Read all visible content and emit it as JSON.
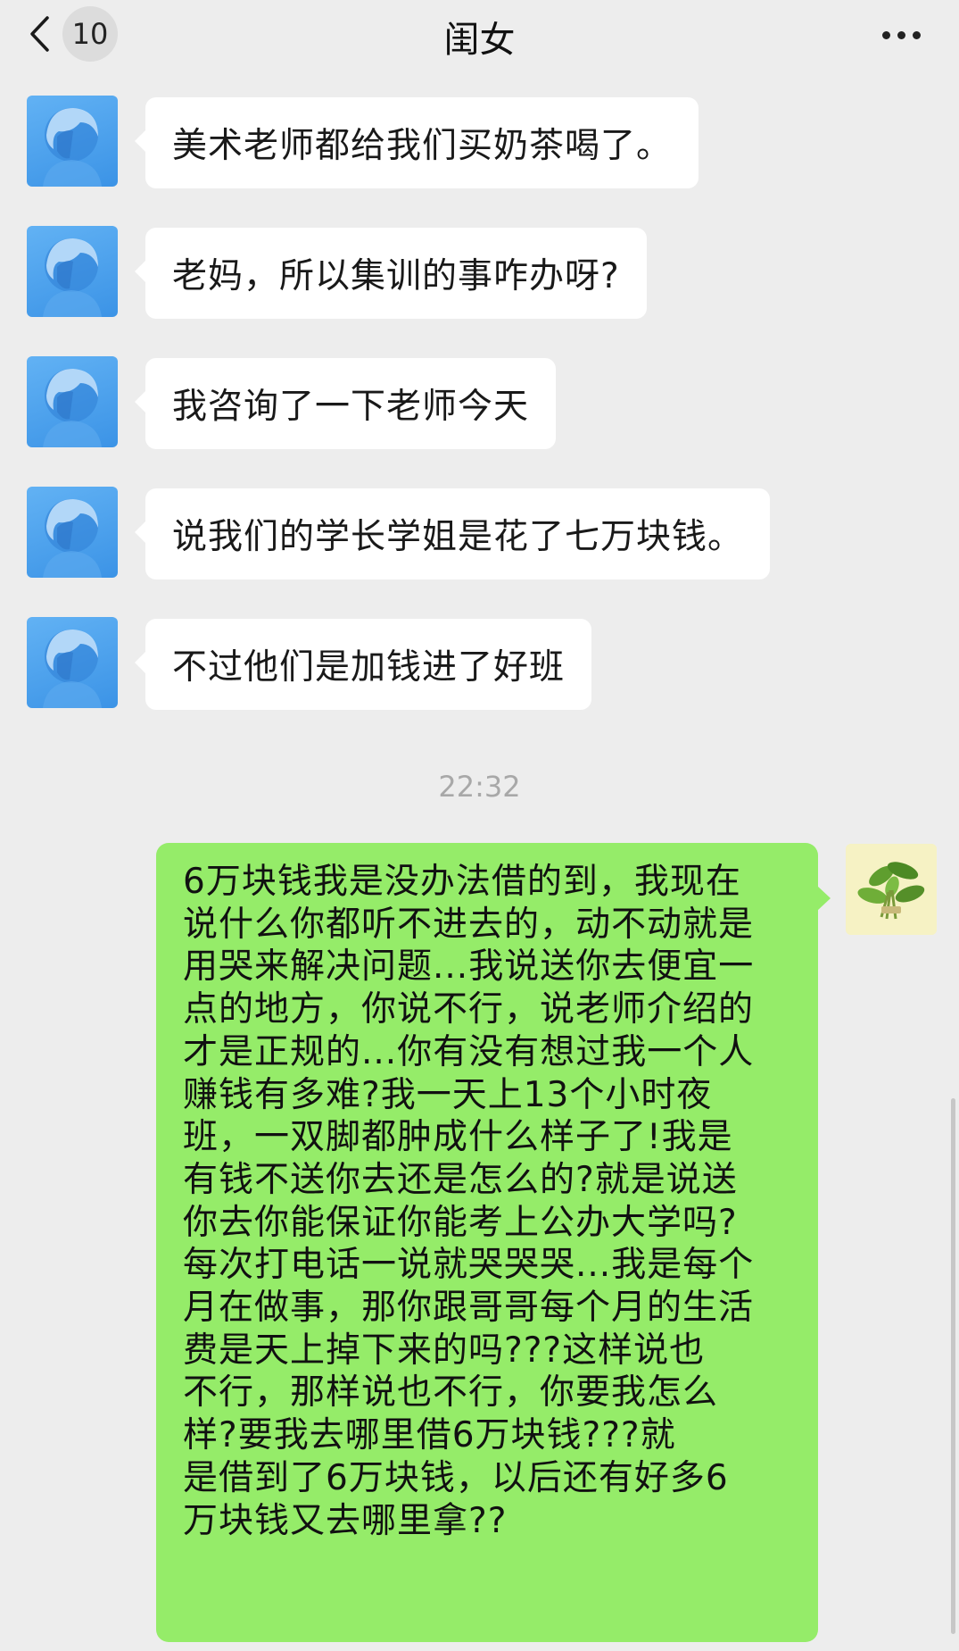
{
  "header": {
    "title": "闺女",
    "unread_count": "10"
  },
  "messages": [
    {
      "sender": "闺女",
      "text": "美术老师都给我们买奶茶喝了。"
    },
    {
      "sender": "闺女",
      "text": "老妈，所以集训的事咋办呀?"
    },
    {
      "sender": "闺女",
      "text": "我咨询了一下老师今天"
    },
    {
      "sender": "闺女",
      "text": "说我们的学长学姐是花了七万块钱。"
    },
    {
      "sender": "闺女",
      "text": "不过他们是加钱进了好班"
    }
  ],
  "timestamp": "22:32",
  "outgoing": {
    "lines": [
      "6万块钱我是没办法借的到，我现在",
      "说什么你都听不进去的，动不动就是",
      "用哭来解决问题...我说送你去便宜一",
      "点的地方，你说不行，说老师介绍的",
      "才是正规的...你有没有想过我一个人",
      "赚钱有多难?我一天上13个小时夜",
      "班，一双脚都肿成什么样子了!我是",
      "有钱不送你去还是怎么的?就是说送",
      "你去你能保证你能考上公办大学吗?",
      "每次打电话一说就哭哭哭...我是每个",
      "月在做事，那你跟哥哥每个月的生活",
      "费是天上掉下来的吗???这样说也",
      "不行，那样说也不行，你要我怎么",
      "样?要我去哪里借6万块钱???就",
      "是借到了6万块钱，以后还有好多6",
      "万块钱又去哪里拿??"
    ]
  },
  "icons": {
    "back": "chevron-left-icon",
    "more": "more-dots-icon",
    "contact_avatar": "anime-avatar",
    "my_avatar": "plant-avatar"
  },
  "colors": {
    "background": "#ededed",
    "incoming_bubble": "#ffffff",
    "outgoing_bubble": "#95ec69",
    "timestamp": "#a8a8a8"
  }
}
